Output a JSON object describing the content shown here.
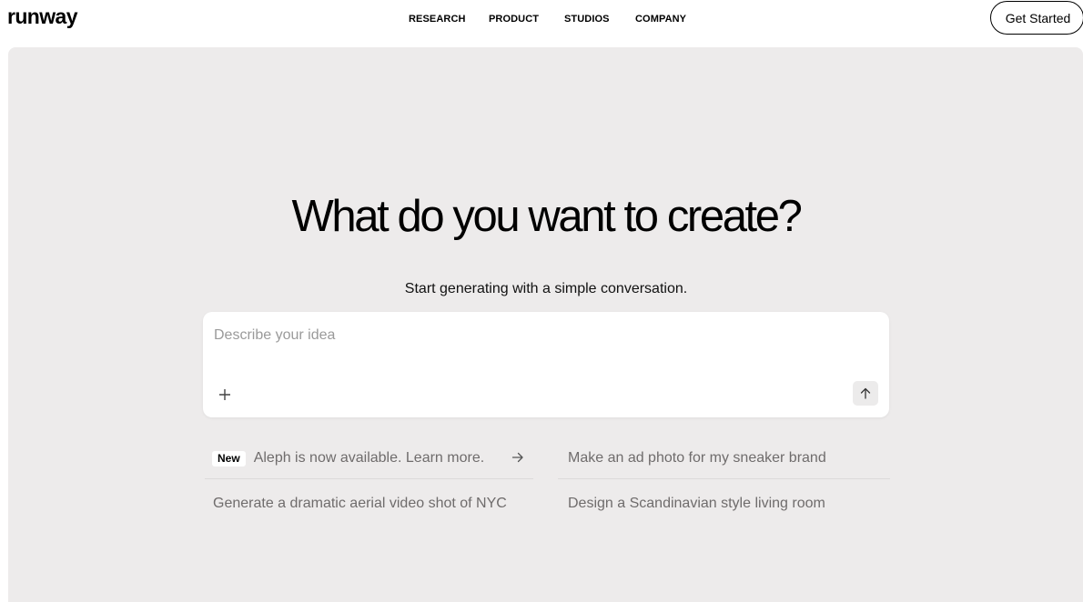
{
  "brand": {
    "logo": "runway"
  },
  "nav": {
    "items": [
      "RESEARCH",
      "PRODUCT",
      "STUDIOS",
      "COMPANY"
    ],
    "cta": "Get Started"
  },
  "hero": {
    "title": "What do you want to create?",
    "subtitle": "Start generating with a simple conversation."
  },
  "prompt": {
    "placeholder": "Describe your idea",
    "add_icon": "plus-icon",
    "send_icon": "arrow-up-icon"
  },
  "suggestions": {
    "announcement": {
      "badge": "New",
      "text": "Aleph is now available. Learn more.",
      "icon": "arrow-right-icon"
    },
    "items": [
      "Make an ad photo for my sneaker brand",
      "Generate a dramatic aerial video shot of NYC",
      "Design a Scandinavian style living room"
    ]
  },
  "colors": {
    "panel_bg": "#edebeb",
    "text": "#000000",
    "muted_text": "#6f6c6c",
    "placeholder": "#9a9a9a"
  }
}
